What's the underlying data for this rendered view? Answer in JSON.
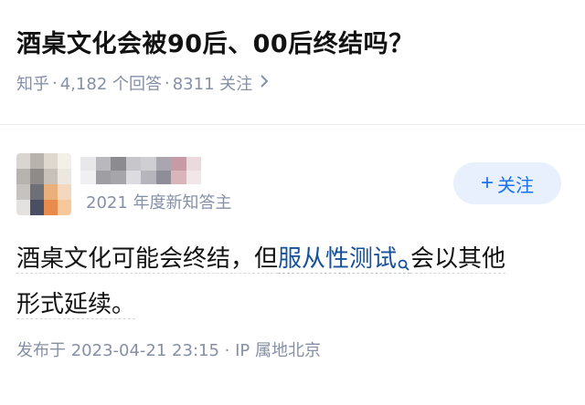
{
  "question": {
    "title": "酒桌文化会被90后、00后终结吗？",
    "meta": {
      "site": "知乎",
      "answers": "4,182 个回答",
      "followers": "8311 关注"
    }
  },
  "author": {
    "badge": "2021 年度新知答主",
    "follow_label": "关注"
  },
  "answer": {
    "text_before": "酒桌文化可能会终结，但",
    "link": "服从性测试",
    "text_after_line1": "会以其他",
    "text_line2": "形式延续。"
  },
  "publish": {
    "text": "发布于 2023-04-21 23:15 · IP 属地北京"
  },
  "colors": {
    "accent": "#1772f6",
    "link": "#175199",
    "meta_gray": "#8590a6",
    "follow_bg": "#e8f0fe"
  },
  "icons": [
    "chevron-right-icon",
    "plus-icon",
    "search-icon"
  ]
}
